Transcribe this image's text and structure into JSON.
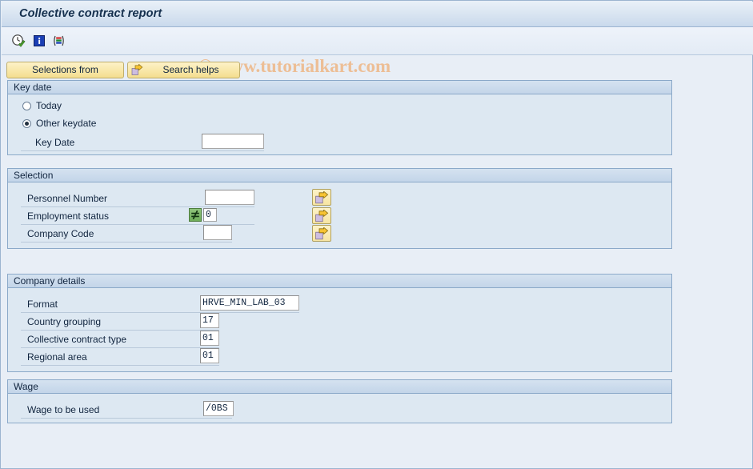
{
  "window": {
    "title": "Collective contract report"
  },
  "toolbar": {
    "icons": [
      {
        "name": "execute-clock-icon",
        "title": "Execute"
      },
      {
        "name": "information-icon",
        "title": "Information"
      },
      {
        "name": "variant-icon",
        "title": "Variant"
      }
    ]
  },
  "watermark": {
    "text": "© www.tutorialkart.com",
    "color": "#edbe95"
  },
  "buttons": {
    "selections_from": "Selections from",
    "search_helps": "Search helps"
  },
  "sections": {
    "key_date": {
      "header": "Key date",
      "radios": [
        {
          "label": "Today",
          "selected": false
        },
        {
          "label": "Other keydate",
          "selected": true
        }
      ],
      "fields": [
        {
          "label": "Key Date",
          "value": "",
          "placeholder": ""
        }
      ]
    },
    "selection": {
      "header": "Selection",
      "fields": [
        {
          "label": "Personnel Number",
          "value": "",
          "operator": null,
          "multi_select": true
        },
        {
          "label": "Employment status",
          "value": "0",
          "operator": "≠",
          "multi_select": true
        },
        {
          "label": "Company Code",
          "value": "",
          "operator": null,
          "multi_select": true
        }
      ]
    },
    "company_details": {
      "header": "Company details",
      "fields": [
        {
          "label": "Format",
          "value": "HRVE_MIN_LAB_03"
        },
        {
          "label": "Country grouping",
          "value": "17"
        },
        {
          "label": "Collective contract type",
          "value": "01"
        },
        {
          "label": "Regional area",
          "value": "01"
        }
      ]
    },
    "wage": {
      "header": "Wage",
      "fields": [
        {
          "label": "Wage to be used",
          "value": "/0BS"
        }
      ]
    }
  },
  "colors": {
    "page_background": "#e8eef6",
    "panel_background": "#dde8f2",
    "panel_border": "#8ba9c9",
    "button_yellow": "#f8e7a8",
    "operator_green": "#6fae5a",
    "text": "#11253f"
  }
}
